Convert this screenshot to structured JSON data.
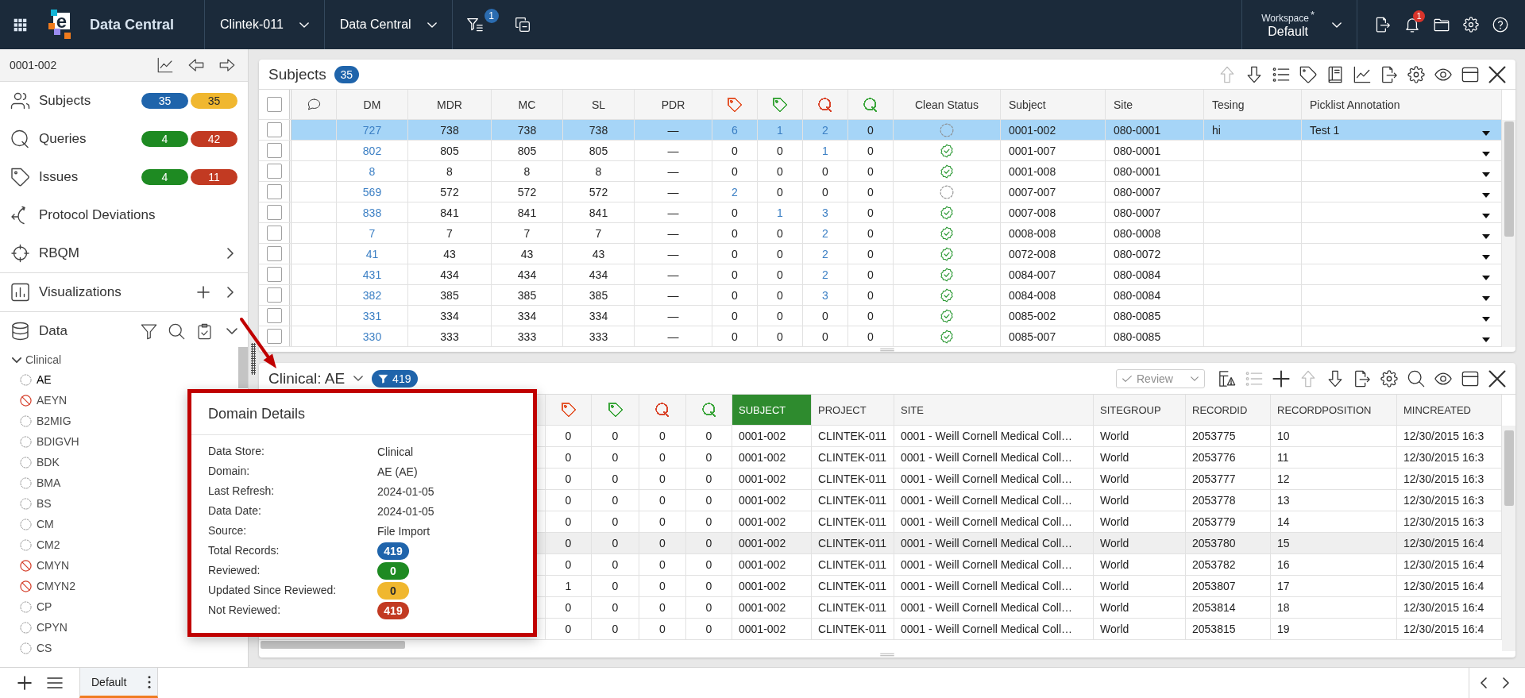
{
  "top_bar": {
    "logo_letter": "e",
    "app_name": "Data Central",
    "menus": [
      {
        "label": "Clintek-011"
      },
      {
        "label": "Data Central"
      }
    ],
    "filter_count": "1",
    "workspace": {
      "label": "Workspace",
      "marker": "*",
      "value": "Default"
    },
    "notification_count": "1"
  },
  "sidebar": {
    "subject_id": "0001-002",
    "nav": [
      {
        "kind": "subjects",
        "label": "Subjects",
        "submenu": false,
        "badges": [
          {
            "text": "35",
            "color": "#1f64ab"
          },
          {
            "text": "35",
            "color": "#f0b72f"
          }
        ]
      },
      {
        "kind": "queries",
        "label": "Queries",
        "submenu": false,
        "badges": [
          {
            "text": "4",
            "color": "#1e8a22"
          },
          {
            "text": "42",
            "color": "#c23a22"
          }
        ]
      },
      {
        "kind": "issues",
        "label": "Issues",
        "submenu": false,
        "badges": [
          {
            "text": "4",
            "color": "#1e8a22"
          },
          {
            "text": "11",
            "color": "#c23a22"
          }
        ]
      },
      {
        "kind": "deviations",
        "label": "Protocol Deviations",
        "submenu": false
      },
      {
        "kind": "rbqm",
        "label": "RBQM",
        "submenu": true
      }
    ],
    "visualizations": {
      "label": "Visualizations"
    },
    "data": {
      "label": "Data",
      "expanded": true,
      "tree": [
        {
          "label": "Clinical",
          "expanded": true,
          "children": [
            {
              "label": "AE",
              "selected": true,
              "disabled": false
            },
            {
              "label": "AEYN",
              "selected": false,
              "disabled": true
            },
            {
              "label": "B2MIG",
              "selected": false,
              "disabled": false
            },
            {
              "label": "BDIGVH",
              "selected": false,
              "disabled": false
            },
            {
              "label": "BDK",
              "selected": false,
              "disabled": false
            },
            {
              "label": "BMA",
              "selected": false,
              "disabled": false
            },
            {
              "label": "BS",
              "selected": false,
              "disabled": false
            },
            {
              "label": "CM",
              "selected": false,
              "disabled": false
            },
            {
              "label": "CM2",
              "selected": false,
              "disabled": false
            },
            {
              "label": "CMYN",
              "selected": false,
              "disabled": true
            },
            {
              "label": "CMYN2",
              "selected": false,
              "disabled": true
            },
            {
              "label": "CP",
              "selected": false,
              "disabled": false
            },
            {
              "label": "CPYN",
              "selected": false,
              "disabled": false
            },
            {
              "label": "CS",
              "selected": false,
              "disabled": false
            }
          ]
        }
      ]
    }
  },
  "subjects_panel": {
    "title": "Subjects",
    "count": "35",
    "toolbar": [
      {
        "kind": "move-up",
        "disabled": true
      },
      {
        "kind": "move-down",
        "disabled": false
      },
      {
        "kind": "list",
        "disabled": false
      },
      {
        "kind": "tag",
        "disabled": false
      },
      {
        "kind": "book",
        "disabled": false
      },
      {
        "kind": "chart",
        "disabled": false
      },
      {
        "kind": "export",
        "disabled": false
      },
      {
        "kind": "settings",
        "disabled": false
      },
      {
        "kind": "view",
        "disabled": false
      },
      {
        "kind": "layout",
        "disabled": false
      },
      {
        "kind": "close",
        "disabled": false
      }
    ],
    "select_all": {
      "checked": false
    },
    "columns": [
      {
        "kind": "text",
        "label": "DM"
      },
      {
        "kind": "text",
        "label": "MDR"
      },
      {
        "kind": "text",
        "label": "MC"
      },
      {
        "kind": "text",
        "label": "SL"
      },
      {
        "kind": "text",
        "label": "PDR"
      },
      {
        "kind": "tag",
        "color": "#e4572e"
      },
      {
        "kind": "tag",
        "color": "#3ca63c"
      },
      {
        "kind": "query",
        "color": "#d9452b"
      },
      {
        "kind": "query",
        "color": "#3ca63c"
      },
      {
        "kind": "status",
        "label": "Clean Status"
      },
      {
        "kind": "text",
        "label": "Subject"
      },
      {
        "kind": "text",
        "label": "Site"
      },
      {
        "kind": "text",
        "label": "Tesing"
      },
      {
        "kind": "picklist",
        "label": "Picklist Annotation"
      }
    ],
    "rows": [
      {
        "selected": true,
        "checked": false,
        "clean": false,
        "cells": [
          "727",
          "738",
          "738",
          "738",
          "—",
          "6",
          "1",
          "2",
          "0",
          "",
          "0001-002",
          "080-0001",
          "hi",
          "Test 1"
        ],
        "linked": [
          true,
          false,
          false,
          false,
          false,
          true,
          true,
          true,
          false
        ]
      },
      {
        "selected": false,
        "checked": false,
        "clean": true,
        "cells": [
          "802",
          "805",
          "805",
          "805",
          "—",
          "0",
          "0",
          "1",
          "0",
          "",
          "0001-007",
          "080-0001",
          "",
          ""
        ],
        "linked": [
          true,
          false,
          false,
          false,
          false,
          false,
          false,
          true,
          false
        ]
      },
      {
        "selected": false,
        "checked": false,
        "clean": true,
        "cells": [
          "8",
          "8",
          "8",
          "8",
          "—",
          "0",
          "0",
          "0",
          "0",
          "",
          "0001-008",
          "080-0001",
          "",
          ""
        ],
        "linked": [
          true,
          false,
          false,
          false,
          false,
          false,
          false,
          false,
          false
        ]
      },
      {
        "selected": false,
        "checked": false,
        "clean": false,
        "cells": [
          "569",
          "572",
          "572",
          "572",
          "—",
          "2",
          "0",
          "0",
          "0",
          "",
          "0007-007",
          "080-0007",
          "",
          ""
        ],
        "linked": [
          true,
          false,
          false,
          false,
          false,
          true,
          false,
          false,
          false
        ]
      },
      {
        "selected": false,
        "checked": false,
        "clean": true,
        "cells": [
          "838",
          "841",
          "841",
          "841",
          "—",
          "0",
          "1",
          "3",
          "0",
          "",
          "0007-008",
          "080-0007",
          "",
          ""
        ],
        "linked": [
          true,
          false,
          false,
          false,
          false,
          false,
          true,
          true,
          false
        ]
      },
      {
        "selected": false,
        "checked": false,
        "clean": true,
        "cells": [
          "7",
          "7",
          "7",
          "7",
          "—",
          "0",
          "0",
          "2",
          "0",
          "",
          "0008-008",
          "080-0008",
          "",
          ""
        ],
        "linked": [
          true,
          false,
          false,
          false,
          false,
          false,
          false,
          true,
          false
        ]
      },
      {
        "selected": false,
        "checked": false,
        "clean": true,
        "cells": [
          "41",
          "43",
          "43",
          "43",
          "—",
          "0",
          "0",
          "2",
          "0",
          "",
          "0072-008",
          "080-0072",
          "",
          ""
        ],
        "linked": [
          true,
          false,
          false,
          false,
          false,
          false,
          false,
          true,
          false
        ]
      },
      {
        "selected": false,
        "checked": false,
        "clean": true,
        "cells": [
          "431",
          "434",
          "434",
          "434",
          "—",
          "0",
          "0",
          "2",
          "0",
          "",
          "0084-007",
          "080-0084",
          "",
          ""
        ],
        "linked": [
          true,
          false,
          false,
          false,
          false,
          false,
          false,
          true,
          false
        ]
      },
      {
        "selected": false,
        "checked": false,
        "clean": true,
        "cells": [
          "382",
          "385",
          "385",
          "385",
          "—",
          "0",
          "0",
          "3",
          "0",
          "",
          "0084-008",
          "080-0084",
          "",
          ""
        ],
        "linked": [
          true,
          false,
          false,
          false,
          false,
          false,
          false,
          true,
          false
        ]
      },
      {
        "selected": false,
        "checked": false,
        "clean": true,
        "cells": [
          "331",
          "334",
          "334",
          "334",
          "—",
          "0",
          "0",
          "0",
          "0",
          "",
          "0085-002",
          "080-0085",
          "",
          ""
        ],
        "linked": [
          true,
          false,
          false,
          false,
          false,
          false,
          false,
          false,
          false
        ]
      },
      {
        "selected": false,
        "checked": false,
        "clean": true,
        "cells": [
          "330",
          "333",
          "333",
          "333",
          "—",
          "0",
          "0",
          "0",
          "0",
          "",
          "0085-007",
          "080-0085",
          "",
          ""
        ],
        "linked": [
          true,
          false,
          false,
          false,
          false,
          false,
          false,
          false,
          false
        ]
      }
    ]
  },
  "clinical_panel": {
    "title": "Clinical: AE",
    "filter_count": "419",
    "review_button": {
      "label": "Review",
      "disabled": true
    },
    "toolbar": [
      {
        "kind": "table-warning",
        "disabled": false
      },
      {
        "kind": "list",
        "disabled": true
      },
      {
        "kind": "add",
        "disabled": false
      },
      {
        "kind": "move-up",
        "disabled": true
      },
      {
        "kind": "move-down",
        "disabled": false
      },
      {
        "kind": "export",
        "disabled": false
      },
      {
        "kind": "settings",
        "disabled": false
      },
      {
        "kind": "search",
        "disabled": false
      },
      {
        "kind": "view",
        "disabled": false
      },
      {
        "kind": "layout",
        "disabled": false
      },
      {
        "kind": "close",
        "disabled": false
      }
    ],
    "columns": [
      {
        "kind": "tag",
        "color": "#e4572e",
        "selected": false
      },
      {
        "kind": "tag",
        "color": "#3ca63c",
        "selected": false
      },
      {
        "kind": "query",
        "color": "#d9452b",
        "selected": false
      },
      {
        "kind": "query",
        "color": "#3ca63c",
        "selected": false
      },
      {
        "kind": "text",
        "label": "SUBJECT",
        "selected": true
      },
      {
        "kind": "text",
        "label": "PROJECT",
        "selected": false
      },
      {
        "kind": "text",
        "label": "SITE",
        "selected": false
      },
      {
        "kind": "text",
        "label": "SITEGROUP",
        "selected": false
      },
      {
        "kind": "text",
        "label": "RECORDID",
        "selected": false
      },
      {
        "kind": "text",
        "label": "RECORDPOSITION",
        "selected": false
      },
      {
        "kind": "text",
        "label": "MINCREATED",
        "selected": false
      }
    ],
    "rows": [
      {
        "highlighted": false,
        "cells": [
          "0",
          "0",
          "0",
          "0",
          "0001-002",
          "CLINTEK-011",
          "0001 - Weill Cornell Medical Coll…",
          "World",
          "2053775",
          "10",
          "12/30/2015 16:3"
        ]
      },
      {
        "highlighted": false,
        "cells": [
          "0",
          "0",
          "0",
          "0",
          "0001-002",
          "CLINTEK-011",
          "0001 - Weill Cornell Medical Coll…",
          "World",
          "2053776",
          "11",
          "12/30/2015 16:3"
        ]
      },
      {
        "highlighted": false,
        "cells": [
          "0",
          "0",
          "0",
          "0",
          "0001-002",
          "CLINTEK-011",
          "0001 - Weill Cornell Medical Coll…",
          "World",
          "2053777",
          "12",
          "12/30/2015 16:3"
        ]
      },
      {
        "highlighted": false,
        "cells": [
          "0",
          "0",
          "0",
          "0",
          "0001-002",
          "CLINTEK-011",
          "0001 - Weill Cornell Medical Coll…",
          "World",
          "2053778",
          "13",
          "12/30/2015 16:3"
        ]
      },
      {
        "highlighted": false,
        "cells": [
          "0",
          "0",
          "0",
          "0",
          "0001-002",
          "CLINTEK-011",
          "0001 - Weill Cornell Medical Coll…",
          "World",
          "2053779",
          "14",
          "12/30/2015 16:3"
        ]
      },
      {
        "highlighted": true,
        "cells": [
          "0",
          "0",
          "0",
          "0",
          "0001-002",
          "CLINTEK-011",
          "0001 - Weill Cornell Medical Coll…",
          "World",
          "2053780",
          "15",
          "12/30/2015 16:4"
        ]
      },
      {
        "highlighted": false,
        "cells": [
          "0",
          "0",
          "0",
          "0",
          "0001-002",
          "CLINTEK-011",
          "0001 - Weill Cornell Medical Coll…",
          "World",
          "2053782",
          "16",
          "12/30/2015 16:4"
        ]
      },
      {
        "highlighted": false,
        "cells": [
          "1",
          "0",
          "0",
          "0",
          "0001-002",
          "CLINTEK-011",
          "0001 - Weill Cornell Medical Coll…",
          "World",
          "2053807",
          "17",
          "12/30/2015 16:4"
        ]
      },
      {
        "highlighted": false,
        "cells": [
          "0",
          "0",
          "0",
          "0",
          "0001-002",
          "CLINTEK-011",
          "0001 - Weill Cornell Medical Coll…",
          "World",
          "2053814",
          "18",
          "12/30/2015 16:4"
        ]
      },
      {
        "highlighted": false,
        "cells": [
          "0",
          "0",
          "0",
          "0",
          "0001-002",
          "CLINTEK-011",
          "0001 - Weill Cornell Medical Coll…",
          "World",
          "2053815",
          "19",
          "12/30/2015 16:4"
        ]
      }
    ]
  },
  "domain_details": {
    "title": "Domain Details",
    "fields": [
      {
        "kind": "text",
        "label": "Data Store:",
        "value": "Clinical"
      },
      {
        "kind": "text",
        "label": "Domain:",
        "value": "AE (AE)"
      },
      {
        "kind": "text",
        "label": "Last Refresh:",
        "value": "2024-01-05"
      },
      {
        "kind": "text",
        "label": "Data Date:",
        "value": "2024-01-05"
      },
      {
        "kind": "text",
        "label": "Source:",
        "value": "File Import"
      },
      {
        "kind": "badge",
        "label": "Total Records:",
        "value": "419",
        "color": "#1f64ab"
      },
      {
        "kind": "badge",
        "label": "Reviewed:",
        "value": "0",
        "color": "#1e8a22"
      },
      {
        "kind": "badge",
        "label": "Updated Since Reviewed:",
        "value": "0",
        "color": "#f0b72f"
      },
      {
        "kind": "badge",
        "label": "Not Reviewed:",
        "value": "419",
        "color": "#c23a22"
      }
    ]
  },
  "bottom_bar": {
    "tabs": [
      {
        "label": "Default",
        "selected": true
      }
    ]
  }
}
